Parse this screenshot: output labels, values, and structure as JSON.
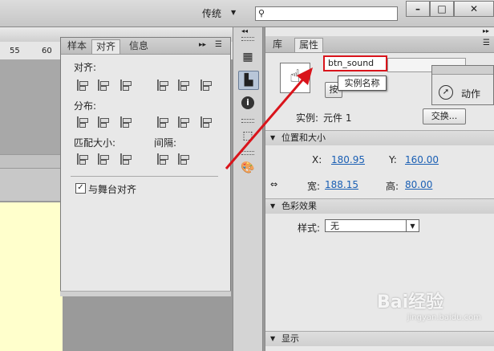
{
  "topbar": {
    "workspace_label": "传统",
    "search_value": ""
  },
  "ruler": {
    "ticks": [
      "55",
      "60"
    ]
  },
  "align_panel": {
    "tabs": [
      "样本",
      "对齐",
      "信息"
    ],
    "sections": {
      "align": "对齐:",
      "distribute": "分布:",
      "match_size": "匹配大小:",
      "spacing": "间隔:"
    },
    "align_to_stage": "与舞台对齐",
    "align_to_stage_checked": true
  },
  "props_panel": {
    "tabs": [
      "库",
      "属性"
    ],
    "instance_name_value": "btn_sound",
    "type_button_partial": "按",
    "instance_of_label": "实例:",
    "instance_of_value": "元件 1",
    "swap_button": "交换...",
    "position_size": {
      "header": "位置和大小",
      "x_label": "X:",
      "x_value": "180.95",
      "y_label": "Y:",
      "y_value": "160.00",
      "w_label": "宽:",
      "w_value": "188.15",
      "h_label": "高:",
      "h_value": "80.00"
    },
    "color_effect": {
      "header": "色彩效果",
      "style_label": "样式:",
      "style_value": "无"
    },
    "display": {
      "header": "显示"
    }
  },
  "actions_panel": {
    "label": "动作"
  },
  "tooltip": {
    "text": "实例名称"
  },
  "watermark": {
    "text": "Bai经验",
    "sub": "jingyan.baidu.com"
  },
  "colors": {
    "highlight_red": "#d9141b",
    "arrow_red": "#d9141b",
    "stage_yellow": "#ffffcc"
  }
}
